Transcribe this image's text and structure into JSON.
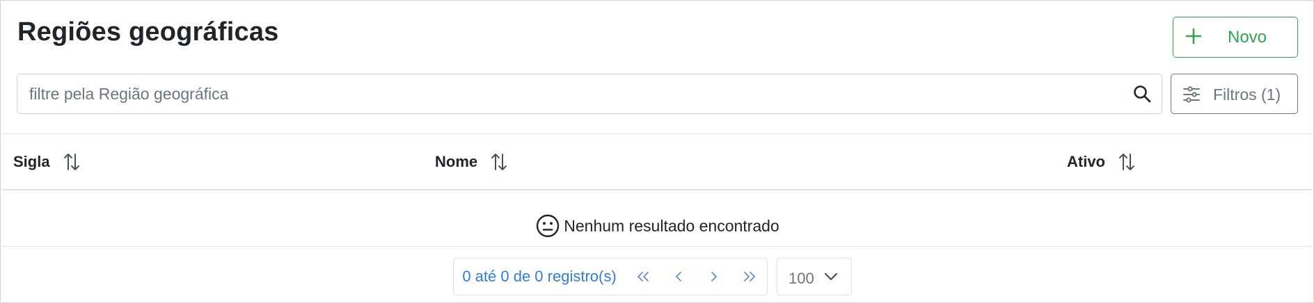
{
  "page": {
    "title": "Regiões geográficas"
  },
  "toolbar": {
    "new_label": "Novo",
    "filters_label": "Filtros (1)"
  },
  "search": {
    "placeholder": "filtre pela Região geográfica",
    "value": ""
  },
  "table": {
    "columns": [
      {
        "label": "Sigla",
        "sortable": true
      },
      {
        "label": "Nome",
        "sortable": true
      },
      {
        "label": "Ativo",
        "sortable": true
      }
    ],
    "rows": [],
    "empty_message": "Nenhum resultado encontrado"
  },
  "pagination": {
    "info": "0 até 0 de 0 registro(s)",
    "page_size": "100"
  },
  "colors": {
    "accent_green": "#2ea44f",
    "link_blue": "#2f7de1",
    "muted_gray": "#6c757d",
    "border": "#dee2e6"
  },
  "icons": [
    "plus-icon",
    "search-icon",
    "sliders-icon",
    "sort-icon",
    "neutral-face-icon",
    "first-page-icon",
    "prev-page-icon",
    "next-page-icon",
    "last-page-icon",
    "chevron-down-icon"
  ]
}
